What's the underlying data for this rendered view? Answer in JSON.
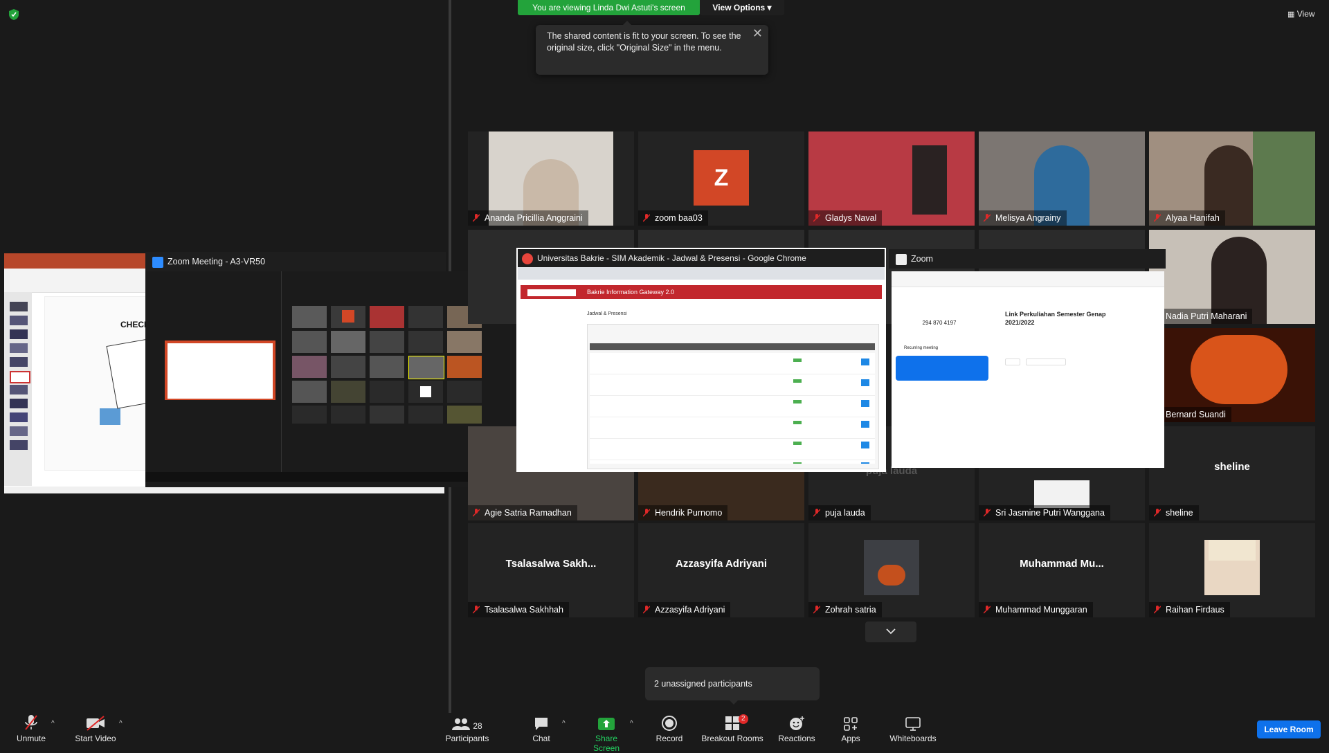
{
  "banner": {
    "viewing": "You are viewing Linda Dwi Astuti's screen",
    "view_options": "View Options"
  },
  "tooltip": {
    "text": "The shared content is fit to your screen. To see the original size, click \"Original Size\" in the menu."
  },
  "top_right": {
    "view": "View"
  },
  "gallery": {
    "row1": [
      "Ananda Pricillia Anggraini",
      "zoom baa03",
      "Gladys Naval",
      "Melisya Angrainy",
      "Alyaa Hanifah"
    ],
    "row2_right": [
      "Nadia Putri Maharani",
      "Bernard Suandi"
    ],
    "row3": [
      "Agie Satria Ramadhan",
      "Hendrik Purnomo",
      "puja lauda",
      "Sri Jasmine Putri Wanggana",
      "sheline"
    ],
    "row3_big_sheline": "sheline",
    "row3_big_puja": "puja lauda",
    "row4": [
      "Tsalasalwa Sakhhah",
      "Azzasyifa Adriyani",
      "Zohrah satria",
      "Muhammad Munggaran",
      "Raihan Firdaus"
    ],
    "row4_big": [
      "Tsalasalwa Sakh...",
      "Azzasyifa Adriyani",
      "Muhammad Mu..."
    ],
    "zoom_initial": "Z"
  },
  "windows": {
    "zoom_meeting": "Zoom Meeting - A3-VR50",
    "chrome": "Universitas Bakrie - SIM Akademik - Jadwal & Presensi - Google Chrome",
    "chrome_header": "Bakrie Information Gateway 2.0",
    "chrome_page_title": "Jadwal & Presensi",
    "zoom_app": "Zoom",
    "zoom_app_meeting_id": "294 870 4197",
    "zoom_app_recurring": "Recurring meeting",
    "zoom_app_link": "Link Perkuliahan Semester Genap 2021/2022",
    "ppt_slide_title": "CHECK L"
  },
  "popup": {
    "unassigned": "2 unassigned participants"
  },
  "toolbar": {
    "unmute": "Unmute",
    "start_video": "Start Video",
    "participants": "Participants",
    "participants_count": "28",
    "chat": "Chat",
    "share_screen": "Share Screen",
    "record": "Record",
    "breakout_rooms": "Breakout Rooms",
    "breakout_badge": "2",
    "reactions": "Reactions",
    "apps": "Apps",
    "whiteboards": "Whiteboards",
    "leave_room": "Leave Room"
  },
  "colors": {
    "banner_green": "#23a33b",
    "leave_blue": "#0e71eb",
    "muted_red": "#e02828",
    "badge_red": "#e02828"
  }
}
